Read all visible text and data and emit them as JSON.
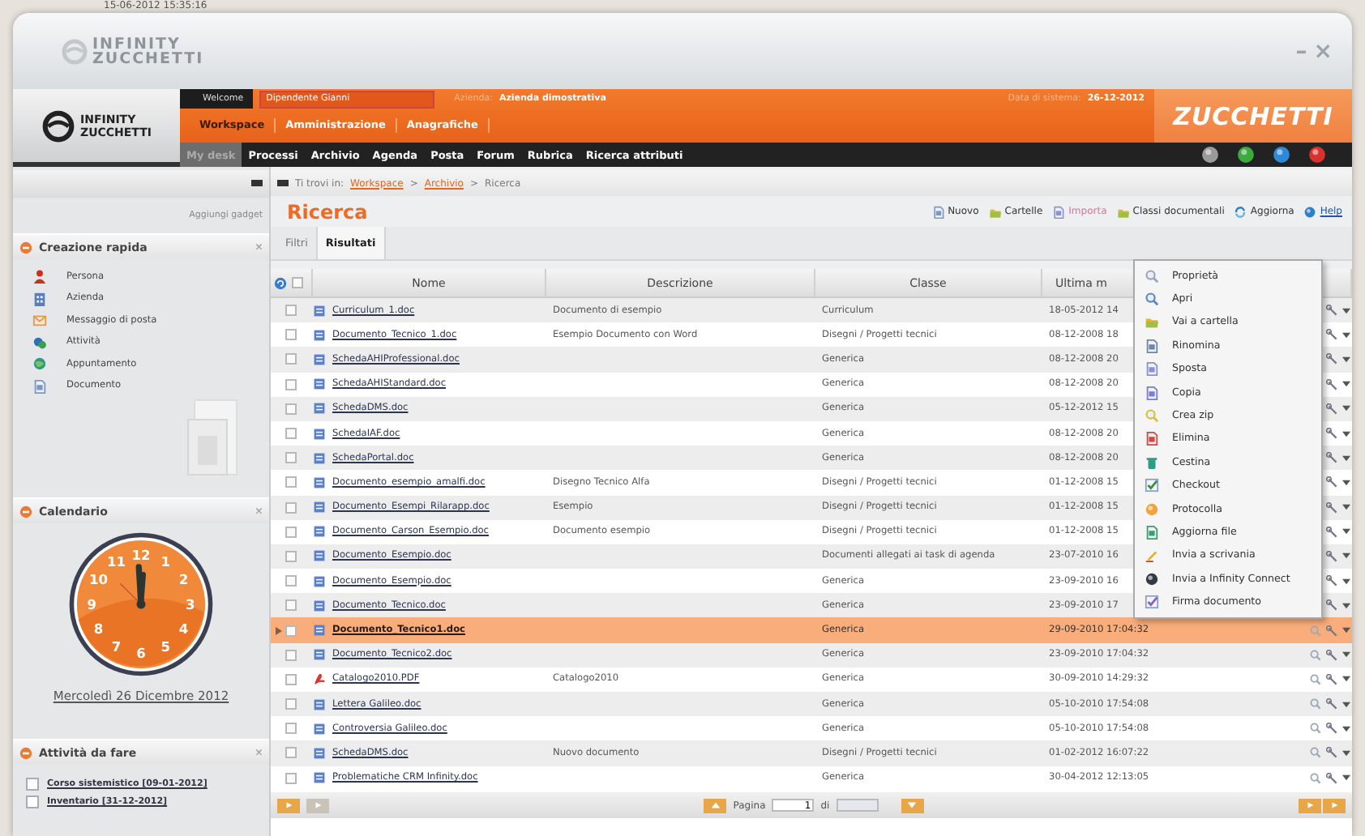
{
  "background": {
    "timestamp": "15-06-2012 15:35:16"
  },
  "window": {
    "logo_lines": [
      "INFINITY",
      "ZUCCHETTI"
    ],
    "controls": [
      "–",
      "×"
    ]
  },
  "header": {
    "logo_lines": [
      "INFINITY",
      "ZUCCHETTI"
    ],
    "welcome_label": "Welcome",
    "user": "Dipendente Gianni",
    "company_label": "Azienda:",
    "company": "Azienda dimostrativa",
    "date_label": "Data di sistema:",
    "date": "26-12-2012",
    "brand": "ZUCCHETTI",
    "sections": [
      {
        "label": "Workspace",
        "selected": true
      },
      {
        "label": "Amministrazione",
        "selected": false
      },
      {
        "label": "Anagrafiche",
        "selected": false
      }
    ],
    "nav": [
      {
        "label": "My desk",
        "selected": true
      },
      {
        "label": "Processi",
        "selected": false
      },
      {
        "label": "Archivio",
        "selected": false
      },
      {
        "label": "Agenda",
        "selected": false
      },
      {
        "label": "Posta",
        "selected": false
      },
      {
        "label": "Forum",
        "selected": false
      },
      {
        "label": "Rubrica",
        "selected": false
      },
      {
        "label": "Ricerca attributi",
        "selected": false
      }
    ]
  },
  "sidebar": {
    "add_gadget": "Aggiungi gadget",
    "quick_create": {
      "title": "Creazione rapida",
      "close": "×",
      "items": [
        {
          "label": "Persona",
          "kind": "person"
        },
        {
          "label": "Azienda",
          "kind": "company"
        },
        {
          "label": "Messaggio di posta",
          "kind": "mail"
        },
        {
          "label": "Attività",
          "kind": "activity"
        },
        {
          "label": "Appuntamento",
          "kind": "appointment"
        },
        {
          "label": "Documento",
          "kind": "document"
        }
      ]
    },
    "calendar": {
      "title": "Calendario",
      "close": "×",
      "numerals": [
        "12",
        "11",
        "1",
        "10",
        "2",
        "9",
        "3",
        "8",
        "4",
        "7",
        "5",
        "6"
      ],
      "date": "Mercoledì 26 Dicembre 2012"
    },
    "todo": {
      "title": "Attività da fare",
      "close": "×",
      "items": [
        {
          "label": "Corso sistemistico [09-01-2012]"
        },
        {
          "label": "Inventario [31-12-2012]"
        }
      ]
    }
  },
  "main": {
    "breadcrumb": [
      {
        "text": "Ti trovi in:",
        "kind": "label"
      },
      {
        "text": "Workspace",
        "kind": "link"
      },
      {
        "text": ">",
        "kind": "sep"
      },
      {
        "text": "Archivio",
        "kind": "link"
      },
      {
        "text": ">",
        "kind": "sep"
      },
      {
        "text": "Ricerca",
        "kind": "label"
      }
    ],
    "title": "Ricerca",
    "actions": [
      {
        "label": "Nuovo",
        "kind": "new"
      },
      {
        "label": "Cartelle",
        "kind": "folder"
      },
      {
        "label": "Importa",
        "kind": "import"
      },
      {
        "label": "Classi documentali",
        "kind": "classes"
      },
      {
        "label": "Aggiorna",
        "kind": "refresh"
      },
      {
        "label": "Help",
        "kind": "help"
      }
    ],
    "tabs": [
      {
        "label": "Filtri",
        "selected": false
      },
      {
        "label": "Risultati",
        "selected": true
      }
    ],
    "table": {
      "select_all_checked": false,
      "columns": [
        "Nome",
        "Descrizione",
        "Classe",
        "Ultima m"
      ],
      "rows": [
        {
          "name": "Curriculum_1.doc",
          "kind": "doc",
          "description": "Documento di esempio",
          "class": "Curriculum",
          "modified": "18-05-2012 14",
          "selected": false
        },
        {
          "name": "Documento_Tecnico_1.doc",
          "kind": "doc",
          "description": "Esempio Documento con Word",
          "class": "Disegni / Progetti tecnici",
          "modified": "08-12-2008 18",
          "selected": false
        },
        {
          "name": "SchedaAHIProfessional.doc",
          "kind": "doc",
          "class": "Generica",
          "modified": "08-12-2008 20",
          "selected": false
        },
        {
          "name": "SchedaAHIStandard.doc",
          "kind": "doc",
          "class": "Generica",
          "modified": "08-12-2008 20",
          "selected": false
        },
        {
          "name": "SchedaDMS.doc",
          "kind": "doc",
          "class": "Generica",
          "modified": "05-12-2012 15",
          "selected": false
        },
        {
          "name": "SchedaIAF.doc",
          "kind": "doc",
          "class": "Generica",
          "modified": "08-12-2008 20",
          "selected": false
        },
        {
          "name": "SchedaPortal.doc",
          "kind": "doc",
          "class": "Generica",
          "modified": "08-12-2008 20",
          "selected": false
        },
        {
          "name": "Documento_esempio_amalfi.doc",
          "kind": "doc",
          "description": "Disegno Tecnico Alfa",
          "class": "Disegni / Progetti tecnici",
          "modified": "01-12-2008 15",
          "selected": false
        },
        {
          "name": "Documento_Esempi_Rilarapp.doc",
          "kind": "doc",
          "description": "Esempio",
          "class": "Disegni / Progetti tecnici",
          "modified": "01-12-2008 15",
          "selected": false
        },
        {
          "name": "Documento_Carson_Esempio.doc",
          "kind": "doc",
          "description": "Documento esempio",
          "class": "Disegni / Progetti tecnici",
          "modified": "01-12-2008 15",
          "selected": false
        },
        {
          "name": "Documento_Esempio.doc",
          "kind": "doc",
          "class": "Documenti allegati ai task di agenda",
          "modified": "23-07-2010 16",
          "selected": false
        },
        {
          "name": "Documento_Esempio.doc",
          "kind": "doc",
          "class": "Generica",
          "modified": "23-09-2010 16",
          "selected": false
        },
        {
          "name": "Documento_Tecnico.doc",
          "kind": "doc",
          "class": "Generica",
          "modified": "23-09-2010 17",
          "selected": false
        },
        {
          "name": "Documento_Tecnico1.doc",
          "kind": "doc",
          "class": "Generica",
          "modified": "29-09-2010 17:04:32",
          "selected": true
        },
        {
          "name": "Documento_Tecnico2.doc",
          "kind": "doc",
          "class": "Generica",
          "modified": "23-09-2010 17:04:32",
          "selected": false
        },
        {
          "name": "Catalogo2010.PDF",
          "kind": "pdf",
          "description": "Catalogo2010",
          "class": "Generica",
          "modified": "30-09-2010 14:29:32",
          "selected": false
        },
        {
          "name": "Lettera Galileo.doc",
          "kind": "doc",
          "class": "Generica",
          "modified": "05-10-2010 17:54:08",
          "selected": false
        },
        {
          "name": "Controversia Galileo.doc",
          "kind": "doc",
          "class": "Generica",
          "modified": "05-10-2010 17:54:08",
          "selected": false
        },
        {
          "name": "SchedaDMS.doc",
          "kind": "doc",
          "description": "Nuovo documento",
          "class": "Disegni / Progetti tecnici",
          "modified": "01-02-2012 16:07:22",
          "selected": false
        },
        {
          "name": "Problematiche CRM Infinity.doc",
          "kind": "doc",
          "class": "Generica",
          "modified": "30-04-2012 12:13:05",
          "selected": false
        }
      ]
    },
    "pagination": {
      "page_label": "Pagina",
      "page": "1",
      "of_label": "di"
    },
    "context_menu": {
      "items": [
        {
          "label": "Proprietà",
          "kind": "properties"
        },
        {
          "label": "Apri",
          "kind": "open"
        },
        {
          "label": "Vai a cartella",
          "kind": "folder"
        },
        {
          "label": "Rinomina",
          "kind": "rename"
        },
        {
          "label": "Sposta",
          "kind": "move"
        },
        {
          "label": "Copia",
          "kind": "copy"
        },
        {
          "label": "Crea zip",
          "kind": "zip"
        },
        {
          "label": "Elimina",
          "kind": "delete"
        },
        {
          "label": "Cestina",
          "kind": "trash"
        },
        {
          "label": "Checkout",
          "kind": "checkout"
        },
        {
          "label": "Protocolla",
          "kind": "protocol"
        },
        {
          "label": "Aggiorna file",
          "kind": "update"
        },
        {
          "label": "Invia a scrivania",
          "kind": "desk"
        },
        {
          "label": "Invia a Infinity Connect",
          "kind": "connect"
        },
        {
          "label": "Firma documento",
          "kind": "sign"
        }
      ]
    }
  }
}
